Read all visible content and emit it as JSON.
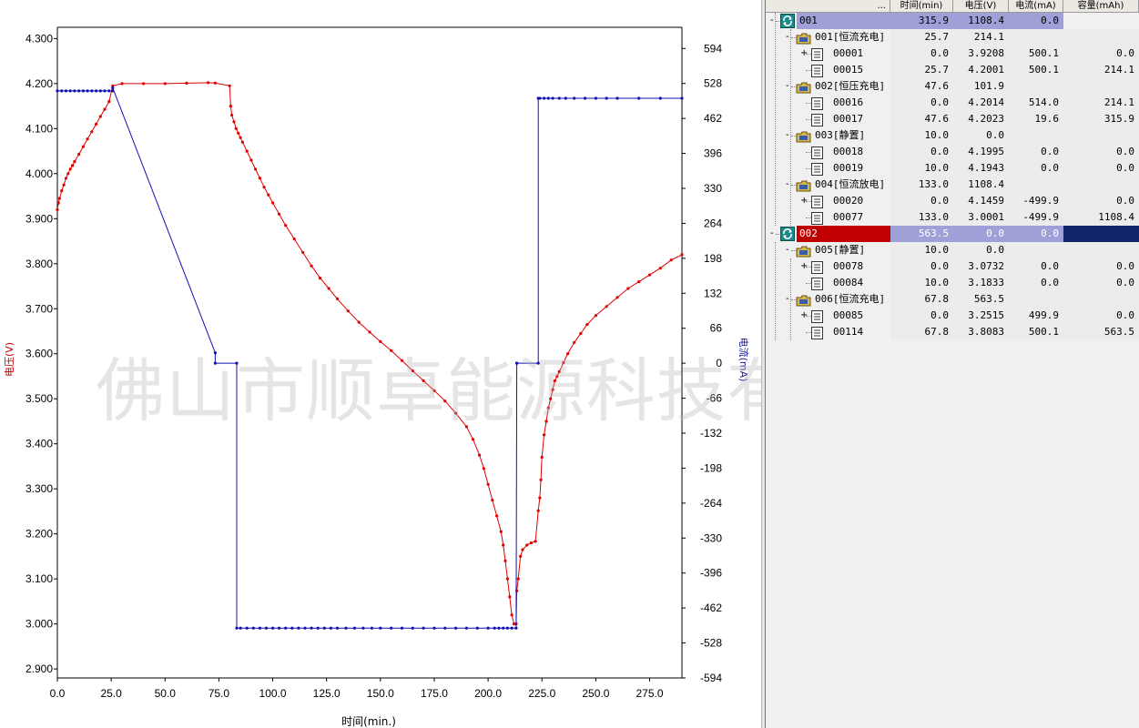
{
  "chart_data": {
    "type": "line",
    "xlabel": "时间(min.)",
    "ylabel_left": "电压(V)",
    "ylabel_right": "电流(mA)",
    "xlim": [
      0,
      290
    ],
    "ylim_left": [
      2.88,
      4.325
    ],
    "ylim_right": [
      -594,
      634
    ],
    "x_ticks": [
      "0.0",
      "25.0",
      "50.0",
      "75.0",
      "100.0",
      "125.0",
      "150.0",
      "175.0",
      "200.0",
      "225.0",
      "250.0",
      "275.0"
    ],
    "y_ticks_left": [
      "2.900",
      "3.000",
      "3.100",
      "3.200",
      "3.300",
      "3.400",
      "3.500",
      "3.600",
      "3.700",
      "3.800",
      "3.900",
      "4.000",
      "4.100",
      "4.200",
      "4.300"
    ],
    "y_ticks_right": [
      "-594",
      "-528",
      "-462",
      "-396",
      "-330",
      "-264",
      "-198",
      "-132",
      "-66",
      "0",
      "66",
      "132",
      "198",
      "264",
      "330",
      "396",
      "462",
      "528",
      "594"
    ],
    "grid": false,
    "series": [
      {
        "name": "电压(V)",
        "color": "#e00000",
        "axis": "left",
        "x": [
          0,
          0.5,
          1,
          2,
          3,
          4,
          5,
          6,
          7,
          8,
          10,
          12,
          14,
          16,
          18,
          20,
          22,
          24,
          25.7,
          30,
          40,
          50,
          60,
          70,
          73.3,
          80,
          80.5,
          81,
          82,
          83,
          84,
          85,
          86,
          88,
          90,
          92,
          94,
          96,
          98,
          100,
          103,
          106,
          110,
          114,
          118,
          122,
          126,
          130,
          135,
          140,
          145,
          150,
          155,
          160,
          165,
          170,
          175,
          180,
          185,
          190,
          193,
          196,
          198,
          200,
          202,
          204,
          206,
          207,
          208,
          209,
          210,
          211,
          212,
          213,
          213.3,
          214,
          215,
          216,
          218,
          220,
          222,
          223.3,
          224,
          224.5,
          225,
          226,
          227,
          228,
          229,
          230,
          231,
          232,
          233,
          235,
          237,
          240,
          243,
          246,
          250,
          255,
          260,
          265,
          270,
          275,
          280,
          285,
          290
        ],
        "y": [
          3.92,
          3.935,
          3.945,
          3.962,
          3.975,
          3.99,
          4.0,
          4.01,
          4.018,
          4.027,
          4.043,
          4.06,
          4.077,
          4.093,
          4.11,
          4.127,
          4.143,
          4.16,
          4.195,
          4.2,
          4.2,
          4.2,
          4.201,
          4.202,
          4.2014,
          4.195,
          4.15,
          4.13,
          4.115,
          4.1,
          4.09,
          4.08,
          4.07,
          4.05,
          4.03,
          4.01,
          3.99,
          3.97,
          3.953,
          3.935,
          3.91,
          3.885,
          3.855,
          3.825,
          3.795,
          3.768,
          3.745,
          3.722,
          3.695,
          3.67,
          3.648,
          3.627,
          3.607,
          3.585,
          3.562,
          3.54,
          3.518,
          3.495,
          3.468,
          3.438,
          3.41,
          3.375,
          3.345,
          3.31,
          3.275,
          3.24,
          3.205,
          3.175,
          3.14,
          3.1,
          3.06,
          3.02,
          3.0,
          3.0001,
          3.0732,
          3.1,
          3.15,
          3.165,
          3.175,
          3.18,
          3.1833,
          3.2515,
          3.28,
          3.32,
          3.37,
          3.42,
          3.45,
          3.48,
          3.5,
          3.52,
          3.54,
          3.55,
          3.56,
          3.58,
          3.6,
          3.625,
          3.645,
          3.665,
          3.685,
          3.705,
          3.725,
          3.745,
          3.76,
          3.775,
          3.79,
          3.8083,
          3.82
        ]
      },
      {
        "name": "电流(mA)",
        "color": "#1010b0",
        "axis": "right",
        "x": [
          0,
          2,
          4,
          6,
          8,
          10,
          12,
          14,
          16,
          18,
          20,
          22,
          24,
          25.7,
          25.7,
          73.3,
          73.3,
          83.3,
          83.3,
          85,
          88,
          91,
          94,
          97,
          100,
          103,
          106,
          109,
          112,
          115,
          118,
          121,
          124,
          127,
          130,
          134,
          138,
          142,
          146,
          150,
          155,
          160,
          165,
          170,
          175,
          180,
          185,
          190,
          195,
          200,
          203,
          205,
          207,
          209,
          211,
          213,
          213.3,
          213.3,
          223.3,
          223.3,
          224,
          226,
          228,
          230,
          233,
          236,
          240,
          245,
          250,
          255,
          260,
          270,
          280,
          290
        ],
        "y": [
          514,
          514,
          514,
          514,
          514,
          514,
          514,
          514,
          514,
          514,
          514,
          514,
          514,
          514,
          519.6,
          19.6,
          0,
          0,
          -499.9,
          -499.9,
          -499.9,
          -499.9,
          -499.9,
          -499.9,
          -499.9,
          -499.9,
          -499.9,
          -499.9,
          -499.9,
          -499.9,
          -499.9,
          -499.9,
          -499.9,
          -499.9,
          -499.9,
          -499.9,
          -499.9,
          -499.9,
          -499.9,
          -499.9,
          -499.9,
          -499.9,
          -499.9,
          -499.9,
          -499.9,
          -499.9,
          -499.9,
          -499.9,
          -499.9,
          -499.9,
          -499.9,
          -499.9,
          -499.9,
          -499.9,
          -499.9,
          -499.9,
          0,
          0,
          0,
          500.1,
          500.1,
          500.1,
          500.1,
          500.1,
          500.1,
          500.1,
          500.1,
          500.1,
          500.1,
          500.1,
          500.1,
          500.1,
          500.1,
          500.1
        ]
      }
    ]
  },
  "watermark": "佛山市顺卓能源科技有限公司",
  "table": {
    "header_first": "...",
    "columns": [
      "时间(min)",
      "电压(V)",
      "电流(mA)",
      "容量(mAh)"
    ],
    "rows": [
      {
        "level": 0,
        "icon": "cycle",
        "label": "001",
        "time": "315.9",
        "volt": "1108.4",
        "curr": "0.0",
        "cap": "",
        "expander": "-",
        "highlight": "cycle1"
      },
      {
        "level": 1,
        "icon": "step",
        "label": "001[恒流充电]",
        "time": "25.7",
        "volt": "214.1",
        "curr": "",
        "cap": "",
        "expander": "-"
      },
      {
        "level": 2,
        "icon": "record",
        "label": "00001",
        "time": "0.0",
        "volt": "3.9208",
        "curr": "500.1",
        "cap": "0.0",
        "expander": "+"
      },
      {
        "level": 2,
        "icon": "record",
        "label": "00015",
        "time": "25.7",
        "volt": "4.2001",
        "curr": "500.1",
        "cap": "214.1",
        "expander": ""
      },
      {
        "level": 1,
        "icon": "step",
        "label": "002[恒压充电]",
        "time": "47.6",
        "volt": "101.9",
        "curr": "",
        "cap": "",
        "expander": "-"
      },
      {
        "level": 2,
        "icon": "record",
        "label": "00016",
        "time": "0.0",
        "volt": "4.2014",
        "curr": "514.0",
        "cap": "214.1",
        "expander": ""
      },
      {
        "level": 2,
        "icon": "record",
        "label": "00017",
        "time": "47.6",
        "volt": "4.2023",
        "curr": "19.6",
        "cap": "315.9",
        "expander": ""
      },
      {
        "level": 1,
        "icon": "step",
        "label": "003[静置]",
        "time": "10.0",
        "volt": "0.0",
        "curr": "",
        "cap": "",
        "expander": "-"
      },
      {
        "level": 2,
        "icon": "record",
        "label": "00018",
        "time": "0.0",
        "volt": "4.1995",
        "curr": "0.0",
        "cap": "0.0",
        "expander": ""
      },
      {
        "level": 2,
        "icon": "record",
        "label": "00019",
        "time": "10.0",
        "volt": "4.1943",
        "curr": "0.0",
        "cap": "0.0",
        "expander": ""
      },
      {
        "level": 1,
        "icon": "step",
        "label": "004[恒流放电]",
        "time": "133.0",
        "volt": "1108.4",
        "curr": "",
        "cap": "",
        "expander": "-"
      },
      {
        "level": 2,
        "icon": "record",
        "label": "00020",
        "time": "0.0",
        "volt": "4.1459",
        "curr": "-499.9",
        "cap": "0.0",
        "expander": "+"
      },
      {
        "level": 2,
        "icon": "record",
        "label": "00077",
        "time": "133.0",
        "volt": "3.0001",
        "curr": "-499.9",
        "cap": "1108.4",
        "expander": ""
      },
      {
        "level": 0,
        "icon": "cycle",
        "label": "002",
        "time": "563.5",
        "volt": "0.0",
        "curr": "0.0",
        "cap": "",
        "expander": "-",
        "highlight": "cycle2"
      },
      {
        "level": 1,
        "icon": "step",
        "label": "005[静置]",
        "time": "10.0",
        "volt": "0.0",
        "curr": "",
        "cap": "",
        "expander": "-"
      },
      {
        "level": 2,
        "icon": "record",
        "label": "00078",
        "time": "0.0",
        "volt": "3.0732",
        "curr": "0.0",
        "cap": "0.0",
        "expander": "+"
      },
      {
        "level": 2,
        "icon": "record",
        "label": "00084",
        "time": "10.0",
        "volt": "3.1833",
        "curr": "0.0",
        "cap": "0.0",
        "expander": ""
      },
      {
        "level": 1,
        "icon": "step",
        "label": "006[恒流充电]",
        "time": "67.8",
        "volt": "563.5",
        "curr": "",
        "cap": "",
        "expander": "-"
      },
      {
        "level": 2,
        "icon": "record",
        "label": "00085",
        "time": "0.0",
        "volt": "3.2515",
        "curr": "499.9",
        "cap": "0.0",
        "expander": "+"
      },
      {
        "level": 2,
        "icon": "record",
        "label": "00114",
        "time": "67.8",
        "volt": "3.8083",
        "curr": "500.1",
        "cap": "563.5",
        "expander": ""
      }
    ]
  }
}
